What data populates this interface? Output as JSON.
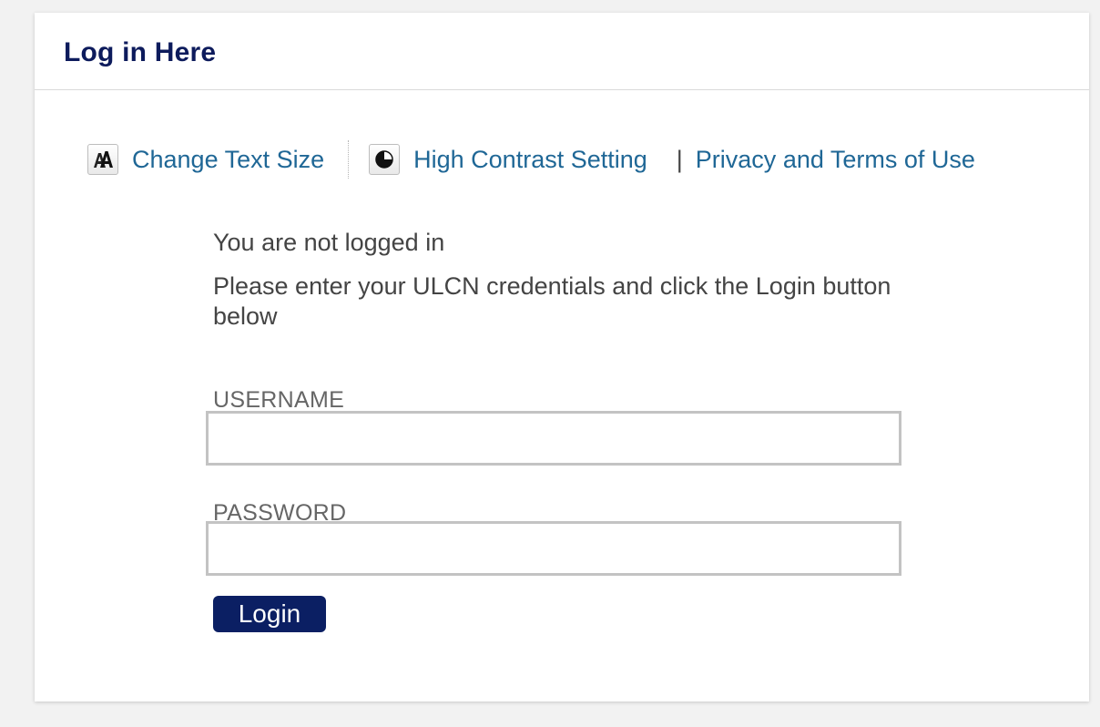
{
  "panel": {
    "title": "Log in Here"
  },
  "toolbar": {
    "text_size_label": "Change Text Size",
    "text_size_icon": "text-size-icon",
    "contrast_label": "High Contrast Setting",
    "contrast_icon": "contrast-icon",
    "separator": "|",
    "privacy_label": "Privacy and Terms of Use"
  },
  "login": {
    "status_text": "You are not logged in",
    "instructions": "Please enter your ULCN credentials and click the Login button below",
    "username_label": "USERNAME",
    "username_value": "",
    "password_label": "PASSWORD",
    "password_value": "",
    "button_label": "Login"
  },
  "colors": {
    "title": "#0d1b5c",
    "link": "#1f6796",
    "button_bg": "#0b1f63",
    "body_text": "#444444"
  }
}
